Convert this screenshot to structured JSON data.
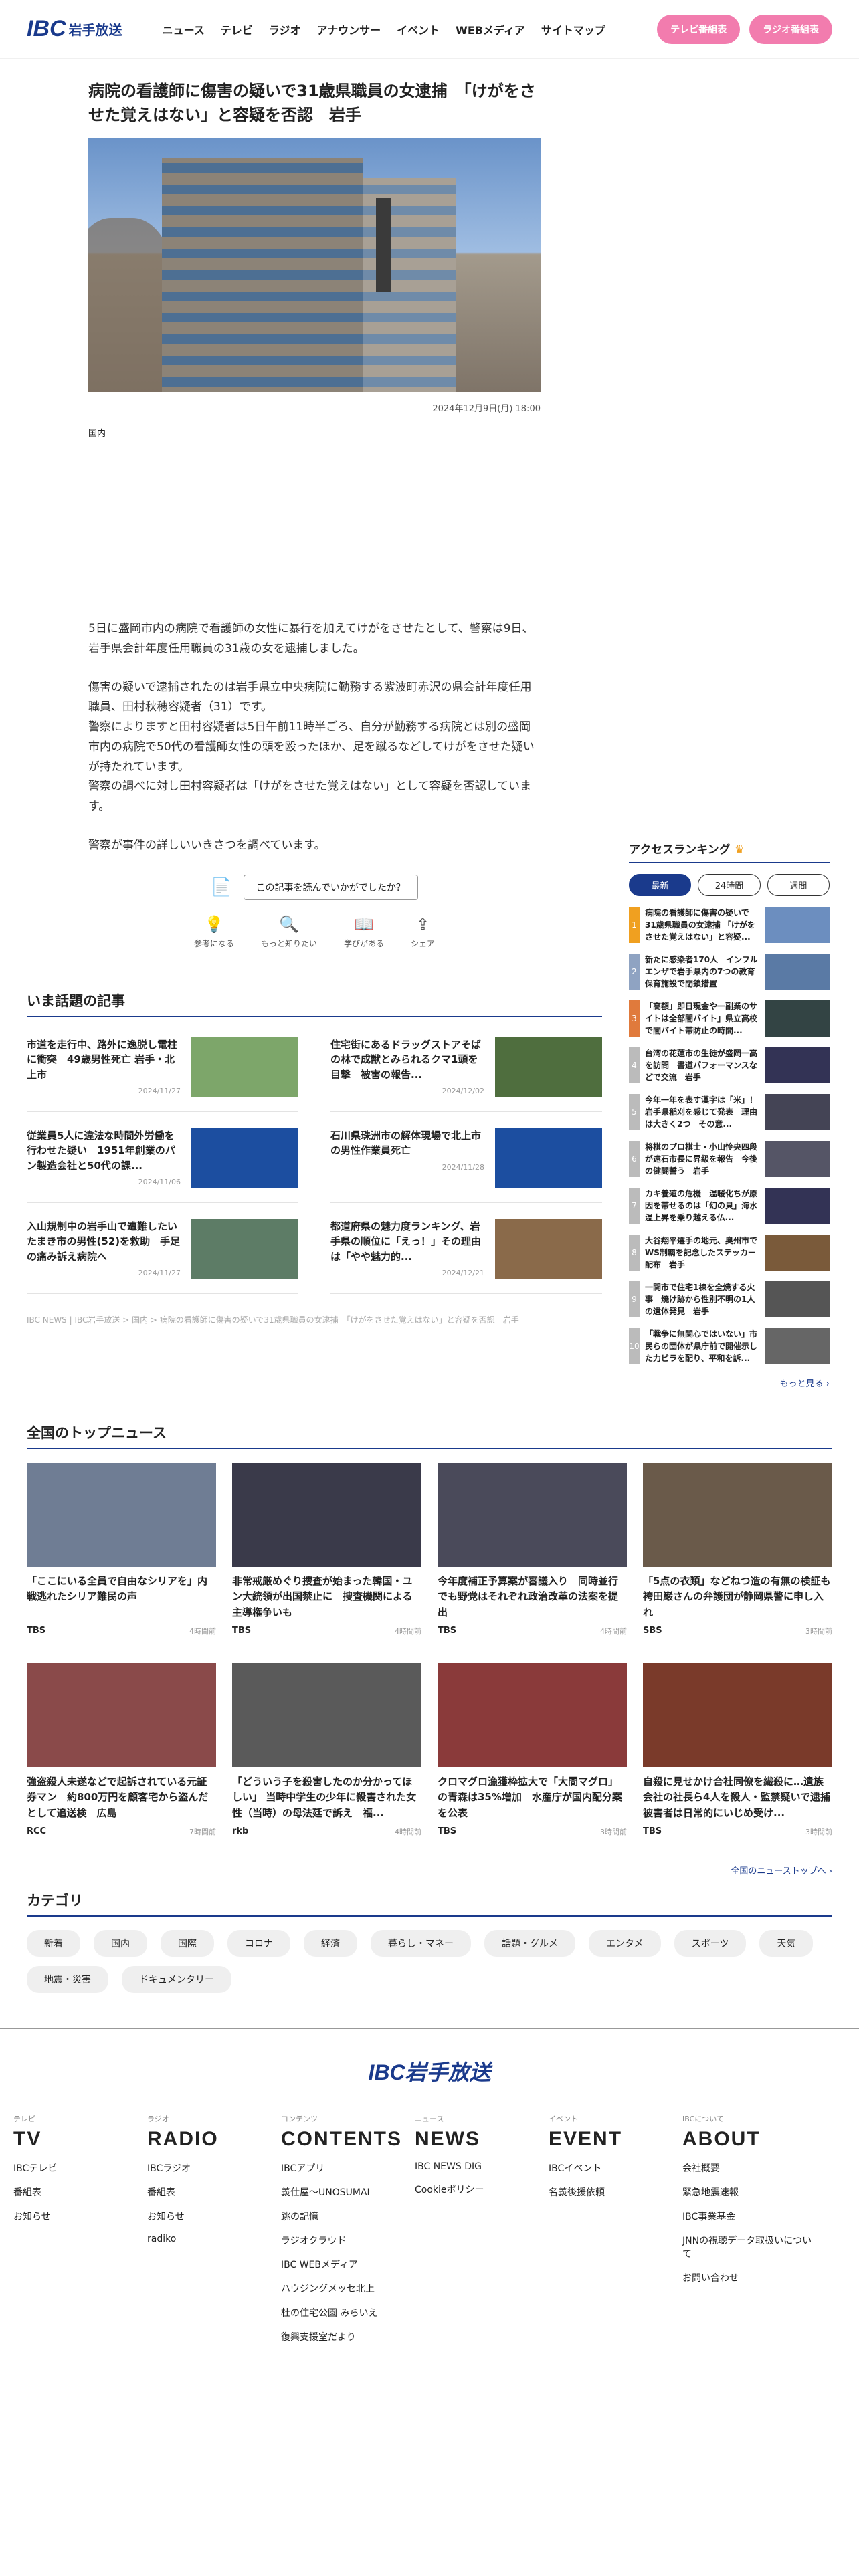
{
  "header": {
    "logo": "IBC",
    "logo_sub": "岩手放送",
    "nav": [
      "ニュース",
      "テレビ",
      "ラジオ",
      "アナウンサー",
      "イベント",
      "WEBメディア",
      "サイトマップ"
    ],
    "tv_button": "テレビ番組表",
    "radio_button": "ラジオ番組表"
  },
  "article": {
    "title": "病院の看護師に傷害の疑いで31歳県職員の女逮捕　「けがをさせた覚えはない」と容疑を否認　岩手",
    "date": "2024年12月9日(月) 18:00",
    "category": "国内",
    "paragraphs": [
      "5日に盛岡市内の病院で看護師の女性に暴行を加えてけがをさせたとして、警察は9日、岩手県会計年度任用職員の31歳の女を逮捕しました。",
      "傷害の疑いで逮捕されたのは岩手県立中央病院に勤務する紫波町赤沢の県会計年度任用職員、田村秋穂容疑者（31）です。\n警察によりますと田村容疑者は5日午前11時半ごろ、自分が勤務する病院とは別の盛岡市内の病院で50代の看護師女性の頭を殴ったほか、足を蹴るなどしてけがをさせた疑いが持たれています。\n警察の調べに対し田村容疑者は「けがをさせた覚えはない」として容疑を否認しています。",
      "警察が事件の詳しいいきさつを調べています。"
    ],
    "feedback": "この記事を読んでいかがでしたか？",
    "reactions": [
      "参考になる",
      "もっと知りたい",
      "学びがある",
      "シェア"
    ]
  },
  "topics": {
    "heading": "いま話題の記事",
    "items": [
      {
        "title": "市道を走行中、路外に逸脱し電柱に衝突　49歳男性死亡 岩手・北上市",
        "date": "2024/11/27",
        "color": "#7da66a"
      },
      {
        "title": "住宅街にあるドラッグストアそばの林で成獣とみられるクマ1頭を目撃　被害の報告...",
        "date": "2024/12/02",
        "color": "#4f6e3e"
      },
      {
        "title": "従業員5人に違法な時間外労働を行わせた疑い　1951年創業のパン製造会社と50代の課...",
        "date": "2024/11/06",
        "color": "#1c4ea0"
      },
      {
        "title": "石川県珠洲市の解体現場で北上市の男性作業員死亡",
        "date": "2024/11/28",
        "color": "#1c4ea0"
      },
      {
        "title": "入山規制中の岩手山で遭難したいたまき市の男性(52)を救助　手足の痛み訴え病院へ",
        "date": "2024/11/27",
        "color": "#5d7c66"
      },
      {
        "title": "都道府県の魅力度ランキング、岩手県の順位に「えっ！」その理由は「やや魅力的...",
        "date": "2024/12/21",
        "color": "#8a6a4a"
      }
    ],
    "breadcrumb": "IBC NEWS | IBC岩手放送 > 国内 > 病院の看護師に傷害の疑いで31歳県職員の女逮捕　「けがをさせた覚えはない」と容疑を否認　岩手"
  },
  "ranking": {
    "heading": "アクセスランキング",
    "tabs": [
      "最新",
      "24時間",
      "週間"
    ],
    "items": [
      {
        "n": "1",
        "title": "病院の看護師に傷害の疑いで31歳県職員の女逮捕 「けがをさせた覚えはない」と容疑...",
        "color": "#6c8ebf"
      },
      {
        "n": "2",
        "title": "新たに感染者170人　インフルエンザで岩手県内の7つの教育保育施設で閉鎖措置",
        "color": "#5a7aa5"
      },
      {
        "n": "3",
        "title": "「高額」即日現金や一副業のサイトは全部闇バイト」県立高校で闇バイト帯防止の時間...",
        "color": "#344"
      },
      {
        "n": "4",
        "title": "台湾の花蓮市の生徒が盛岡一高を訪問　書道パフォーマンスなどで交流　岩手",
        "color": "#335"
      },
      {
        "n": "5",
        "title": "今年一年を表す漢字は「米」！ 岩手県稲刈を感じて発表　理由は大きく2つ　その意...",
        "color": "#445"
      },
      {
        "n": "6",
        "title": "将棋のプロ棋士・小山怜央四段が遠石市長に昇級を報告　今後の健闘誓う　岩手",
        "color": "#556"
      },
      {
        "n": "7",
        "title": "カキ養殖の危機　温暖化ちが原因を帯せるのは「幻の貝」海水温上昇を乗り越える仏...",
        "color": "#335"
      },
      {
        "n": "8",
        "title": "大谷翔平選手の地元、奥州市でWS制覇を記念したステッカー配布　岩手",
        "color": "#7a5a3a"
      },
      {
        "n": "9",
        "title": "一関市で住宅1棟を全焼する火事　焼け跡から性別不明の1人の遺体発見　岩手",
        "color": "#555"
      },
      {
        "n": "10",
        "title": "「戦争に無関心ではいない」市民らの団体が県庁前で開催示した力ビラを配り、平和を訴...",
        "color": "#666"
      }
    ],
    "more": "もっと見る ›"
  },
  "national": {
    "heading": "全国のトップニュース",
    "items": [
      {
        "title": "「ここにいる全員で自由なシリアを」内戦逃れたシリア難民の声",
        "src": "TBS",
        "time": "4時間前",
        "color": "#6f7d94"
      },
      {
        "title": "非常戒厳めぐり捜査が始まった韓国・ユン大統領が出国禁止に　捜査機関による主導権争いも",
        "src": "TBS",
        "time": "4時間前",
        "color": "#3a3a4a"
      },
      {
        "title": "今年度補正予算案が審議入り　同時並行でも野党はそれぞれ政治改革の法案を提出",
        "src": "TBS",
        "time": "4時間前",
        "color": "#4a4a5a"
      },
      {
        "title": "「5点の衣類」などねつ造の有無の検証も 袴田巌さんの弁護団が静岡県警に申し入れ",
        "src": "SBS",
        "time": "3時間前",
        "color": "#6a5a4a"
      },
      {
        "title": "強盗殺人未遂などで起訴されている元証券マン　約800万円を顧客宅から盗んだとして追送検　広島",
        "src": "RCC",
        "time": "7時間前",
        "color": "#8a4a4a"
      },
      {
        "title": "「どういう子を殺害したのか分かってほしい」 当時中学生の少年に殺害された女性（当時）の母法廷で訴え　福...",
        "src": "rkb",
        "time": "4時間前",
        "color": "#5a5a5a"
      },
      {
        "title": "クロマグロ漁獲枠拡大で「大間マグロ」の青森は35%増加　水産庁が国内配分案を公表",
        "src": "TBS",
        "time": "3時間前",
        "color": "#8a3a3a"
      },
      {
        "title": "自殺に見せかけ合社同僚を繊殺に…遺族会社の社長ら4人を殺人・監禁疑いで逮捕　被害者は日常的にいじめ受け...",
        "src": "TBS",
        "time": "3時間前",
        "color": "#7a3a2a"
      }
    ],
    "more": "全国のニューストップへ ›"
  },
  "categories": {
    "heading": "カテゴリ",
    "items": [
      "新着",
      "国内",
      "国際",
      "コロナ",
      "経済",
      "暮らし・マネー",
      "話題・グルメ",
      "エンタメ",
      "スポーツ",
      "天気",
      "地震・災害",
      "ドキュメンタリー"
    ]
  },
  "footer": {
    "logo": "IBC岩手放送",
    "cols": [
      {
        "lab": "テレビ",
        "head": "TV",
        "items": [
          "IBCテレビ",
          "番組表",
          "お知らせ"
        ]
      },
      {
        "lab": "ラジオ",
        "head": "RADIO",
        "items": [
          "IBCラジオ",
          "番組表",
          "お知らせ",
          "radiko"
        ]
      },
      {
        "lab": "コンテンツ",
        "head": "CONTENTS",
        "items": [
          "IBCアプリ",
          "義仕屋〜UNOSUMAI",
          "跳の記憶",
          "ラジオクラウド",
          "IBC WEBメディア",
          "ハウジングメッセ北上",
          "杜の住宅公園 みらいえ",
          "復興支援室だより"
        ]
      },
      {
        "lab": "ニュース",
        "head": "NEWS",
        "items": [
          "IBC NEWS DIG",
          "Cookieポリシー"
        ]
      },
      {
        "lab": "イベント",
        "head": "EVENT",
        "items": [
          "IBCイベント",
          "名義後援依頼"
        ]
      },
      {
        "lab": "IBCについて",
        "head": "ABOUT",
        "items": [
          "会社概要",
          "緊急地震速報",
          "IBC事業基金",
          "JNNの視聴データ取扱いについて",
          "お問い合わせ"
        ]
      }
    ]
  }
}
